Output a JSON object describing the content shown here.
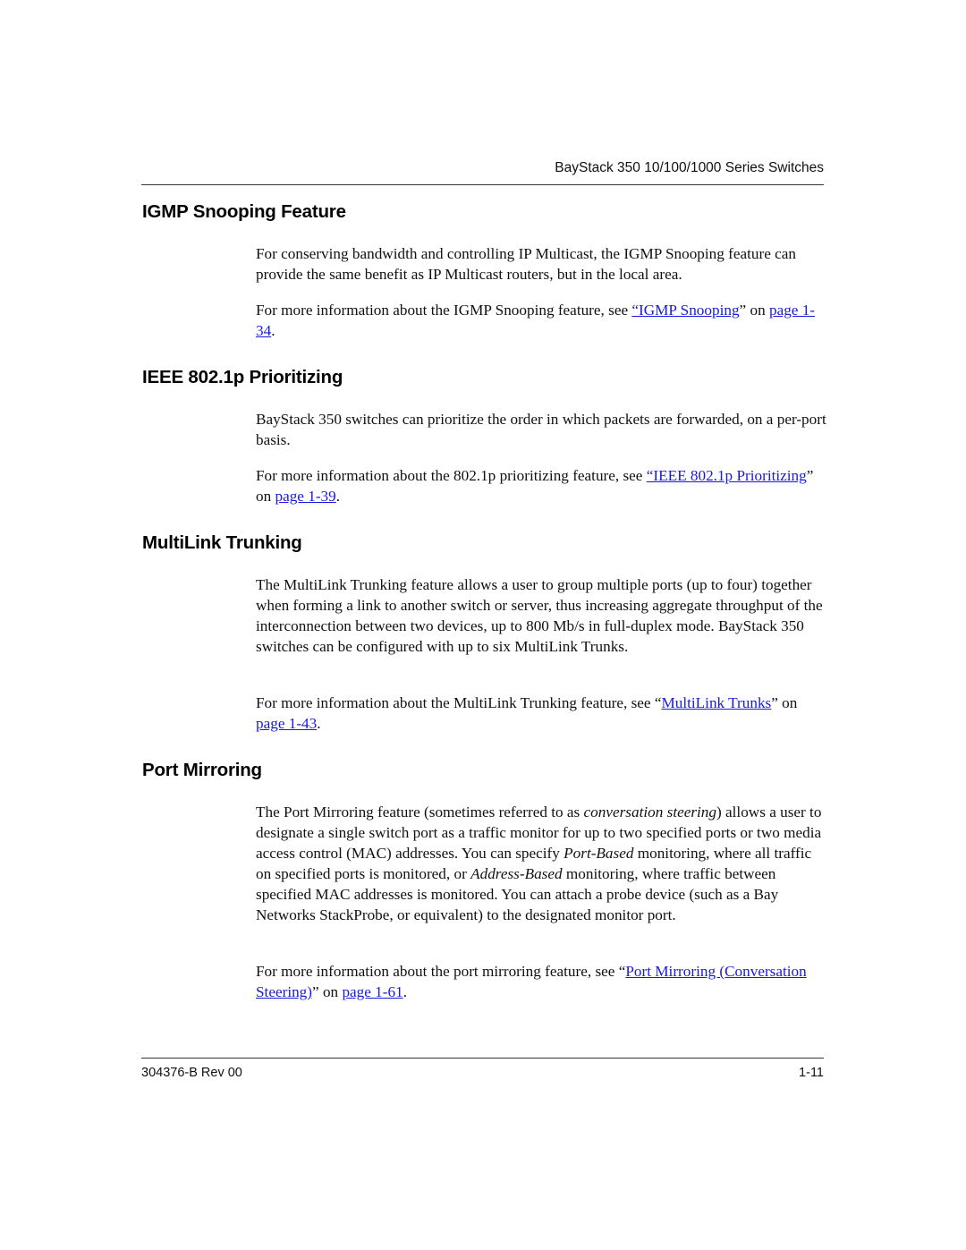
{
  "header": {
    "running_title": "BayStack 350 10/100/1000 Series Switches"
  },
  "sections": [
    {
      "heading": "IGMP Snooping Feature",
      "body": "For conserving bandwidth and controlling IP Multicast, the IGMP Snooping feature can provide the same benefit as IP Multicast routers, but in the local area.",
      "more_prefix": "For more information about the IGMP Snooping feature, see ",
      "link_text": "“IGMP Snooping",
      "link_suffix": "” on ",
      "page_link": "page 1-34",
      "end": "."
    },
    {
      "heading": "IEEE 802.1p Prioritizing",
      "body": "BayStack 350 switches can prioritize the order in which packets are forwarded, on a per-port basis.",
      "more_prefix": "For more information about the 802.1p prioritizing feature, see ",
      "link_text": "“IEEE 802.1p Prioritizing",
      "link_suffix": "” on ",
      "page_link": "page 1-39",
      "end": "."
    },
    {
      "heading": "MultiLink Trunking",
      "body": "The MultiLink Trunking feature allows a user to group multiple ports (up to four) together when forming a link to another switch or server, thus increasing aggregate throughput of the interconnection between two devices, up to 800 Mb/s in full-duplex mode. BayStack 350 switches can be configured with up to six MultiLink Trunks.",
      "more_prefix": "For more information about the MultiLink Trunking feature, see “",
      "link_text": "MultiLink Trunks",
      "link_suffix": "” on ",
      "page_link": "page 1-43",
      "end": "."
    },
    {
      "heading": "Port Mirroring",
      "body_part1": "The Port Mirroring feature (sometimes referred to as ",
      "body_italic1": "conversation steering",
      "body_part2": ") allows a user to designate a single switch port as a traffic monitor for up to two specified ports or two media access control (MAC) addresses. You can specify ",
      "body_italic2": "Port-Based",
      "body_part3": " monitoring, where all traffic on specified ports is monitored, or ",
      "body_italic3": "Address-Based",
      "body_part4": " monitoring, where traffic between specified MAC addresses is monitored. You can attach a probe device (such as a Bay Networks StackProbe, or equivalent) to the designated monitor port.",
      "more_prefix": "For more information about the port mirroring feature, see “",
      "link_text": "Port Mirroring (Conversation Steering)",
      "link_suffix": "” on ",
      "page_link": "page 1-61",
      "end": "."
    }
  ],
  "footer": {
    "doc_number": "304376-B Rev 00",
    "page_number": "1-11"
  }
}
